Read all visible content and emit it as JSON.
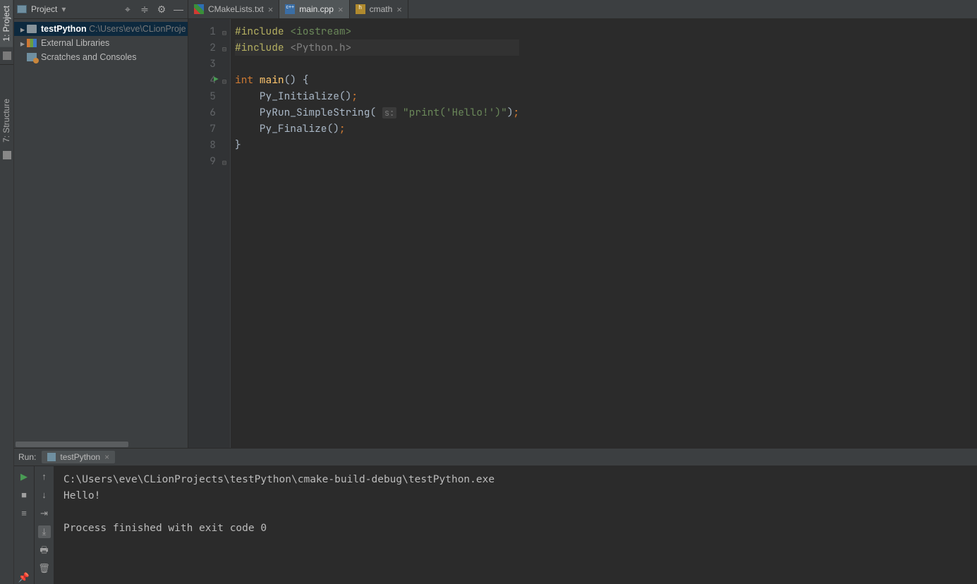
{
  "leftEdge": {
    "projectTab": "1: Project",
    "structureTab": "7: Structure"
  },
  "projectPanel": {
    "title": "Project",
    "tree": {
      "root": {
        "name": "testPython",
        "path": "C:\\Users\\eve\\CLionProje"
      },
      "external": "External Libraries",
      "scratches": "Scratches and Consoles"
    }
  },
  "tabs": [
    {
      "label": "CMakeLists.txt"
    },
    {
      "label": "main.cpp"
    },
    {
      "label": "cmath"
    }
  ],
  "code": {
    "l1a": "#include ",
    "l1b": "<iostream>",
    "l2a": "#include ",
    "l2b": "<Python.h>",
    "l4a": "int",
    "l4b": " main",
    "l4c": "() {",
    "l5a": "    Py_Initialize",
    "l5b": "()",
    "l5c": ";",
    "l6a": "    PyRun_SimpleString",
    "l6b": "( ",
    "l6hint": "s:",
    "l6c": " \"print('Hello!')\"",
    "l6d": ")",
    "l6e": ";",
    "l7a": "    Py_Finalize",
    "l7b": "()",
    "l7c": ";",
    "l8": "}"
  },
  "lineNumbers": [
    "1",
    "2",
    "3",
    "4",
    "5",
    "6",
    "7",
    "8",
    "9"
  ],
  "run": {
    "label": "Run:",
    "config": "testPython",
    "out1": "C:\\Users\\eve\\CLionProjects\\testPython\\cmake-build-debug\\testPython.exe",
    "out2": "Hello!",
    "out3": "",
    "out4": "Process finished with exit code 0"
  }
}
